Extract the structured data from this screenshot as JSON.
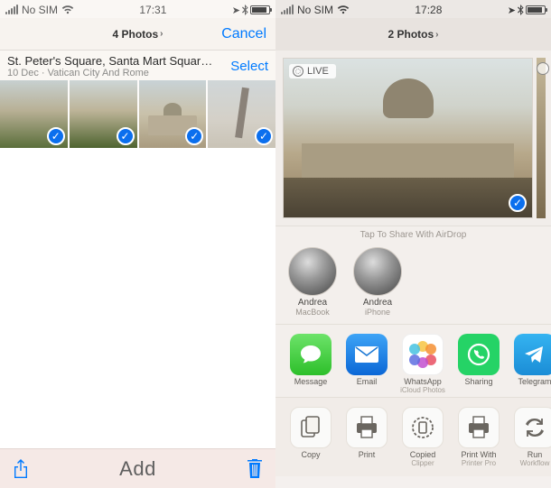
{
  "left": {
    "status": {
      "carrier": "No SIM",
      "time": "17:31"
    },
    "nav": {
      "title": "4 Photos",
      "cancel": "Cancel"
    },
    "moment": {
      "title": "St. Peter's Square, Santa Mart Square,…",
      "subtitle": "10 Dec · Vatican City And Rome",
      "select": "Select"
    },
    "toolbar": {
      "add": "Add"
    }
  },
  "right": {
    "status": {
      "carrier": "No SIM",
      "time": "17:28"
    },
    "nav": {
      "title": "2 Photos"
    },
    "live_badge": "LIVE",
    "share": {
      "tap_label": "Tap To Share With AirDrop",
      "contacts": [
        {
          "name": "Andrea",
          "device": "MacBook"
        },
        {
          "name": "Andrea",
          "device": "iPhone"
        }
      ],
      "apps": [
        {
          "id": "message",
          "label": "Message",
          "sublabel": ""
        },
        {
          "id": "mail",
          "label": "Email",
          "sublabel": ""
        },
        {
          "id": "photos",
          "label": "WhatsApp",
          "sublabel": "iCloud Photos"
        },
        {
          "id": "whatsapp",
          "label": "Sharing",
          "sublabel": ""
        },
        {
          "id": "telegram",
          "label": "Telegram",
          "sublabel": ""
        }
      ],
      "actions": [
        {
          "id": "copy",
          "label": "Copy",
          "sublabel": ""
        },
        {
          "id": "print",
          "label": "Print",
          "sublabel": ""
        },
        {
          "id": "clips",
          "label": "Copied",
          "sublabel": "Clipper"
        },
        {
          "id": "printerpro",
          "label": "Print With",
          "sublabel": "Printer Pro"
        },
        {
          "id": "workflow",
          "label": "Run",
          "sublabel": "Workflow"
        }
      ]
    }
  }
}
